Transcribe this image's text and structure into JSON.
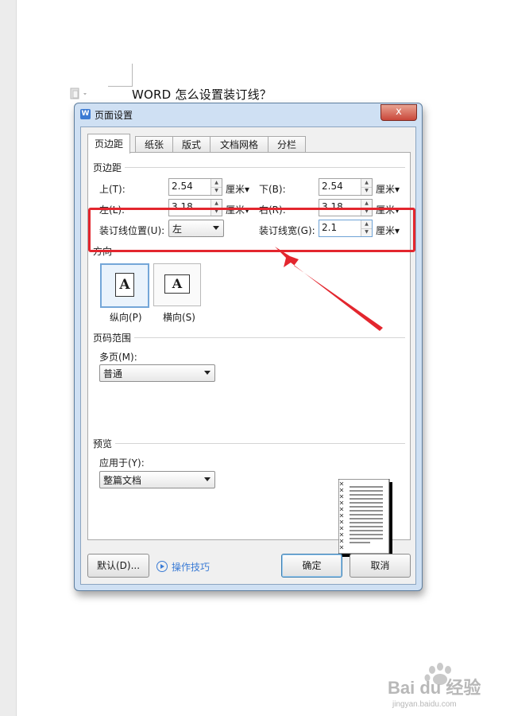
{
  "document": {
    "title": "WORD 怎么设置装订线？"
  },
  "dialog": {
    "title": "页面设置",
    "app_icon_letter": "W",
    "close_label": "x",
    "tabs": [
      "页边距",
      "纸张",
      "版式",
      "文档网格",
      "分栏"
    ],
    "active_tab": "页边距",
    "margins": {
      "section_label": "页边距",
      "top_label": "上(T):",
      "top_value": "2.54",
      "top_unit": "厘米▾",
      "bottom_label": "下(B):",
      "bottom_value": "2.54",
      "bottom_unit": "厘米▾",
      "left_label": "左(L):",
      "left_value": "3.18",
      "left_unit": "厘米▾",
      "right_label": "右(R):",
      "right_value": "3.18",
      "right_unit": "厘米▾",
      "gutter_pos_label": "装订线位置(U):",
      "gutter_pos_value": "左",
      "gutter_width_label": "装订线宽(G):",
      "gutter_width_value": "2.1",
      "gutter_width_unit": "厘米▾"
    },
    "orientation": {
      "section_label": "方向",
      "portrait_label": "纵向(P)",
      "landscape_label": "横向(S)",
      "glyph": "A"
    },
    "page_range": {
      "section_label": "页码范围",
      "multiple_pages_label": "多页(M):",
      "multiple_pages_value": "普通"
    },
    "preview": {
      "section_label": "预览",
      "apply_to_label": "应用于(Y):",
      "apply_to_value": "整篇文档"
    },
    "buttons": {
      "default_label": "默认(D)...",
      "tips_label": "操作技巧",
      "ok_label": "确定",
      "cancel_label": "取消"
    }
  },
  "watermark": {
    "brand": "Bai du 经验",
    "url": "jingyan.baidu.com"
  },
  "colors": {
    "highlight": "#e3262e",
    "accent": "#3a7bd5",
    "dialog_frame": "#cfe0f3"
  }
}
